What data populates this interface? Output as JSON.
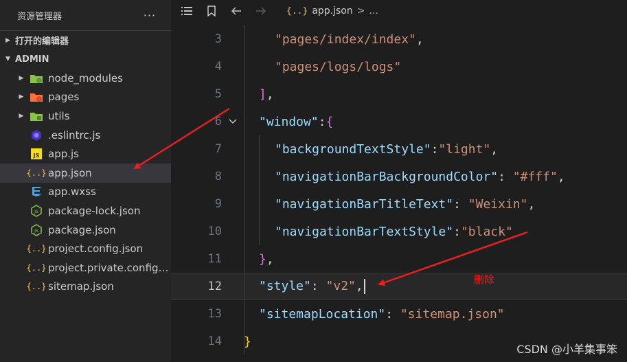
{
  "sidebar": {
    "title": "资源管理器",
    "more_label": "···",
    "open_editors_label": "打开的编辑器",
    "project_label": "ADMIN",
    "items": [
      {
        "label": "node_modules",
        "kind": "folder",
        "icon": "folder-node-icon"
      },
      {
        "label": "pages",
        "kind": "folder",
        "icon": "folder-pages-icon"
      },
      {
        "label": "utils",
        "kind": "folder",
        "icon": "folder-utils-icon"
      },
      {
        "label": ".eslintrc.js",
        "kind": "file",
        "icon": "eslint-icon"
      },
      {
        "label": "app.js",
        "kind": "file",
        "icon": "js-icon"
      },
      {
        "label": "app.json",
        "kind": "file",
        "icon": "json-icon",
        "selected": true
      },
      {
        "label": "app.wxss",
        "kind": "file",
        "icon": "css-icon"
      },
      {
        "label": "package-lock.json",
        "kind": "file",
        "icon": "nodejs-icon"
      },
      {
        "label": "package.json",
        "kind": "file",
        "icon": "nodejs-icon"
      },
      {
        "label": "project.config.json",
        "kind": "file",
        "icon": "json-icon"
      },
      {
        "label": "project.private.config.js...",
        "kind": "file",
        "icon": "json-icon"
      },
      {
        "label": "sitemap.json",
        "kind": "file",
        "icon": "json-icon"
      }
    ]
  },
  "breadcrumb": {
    "file_icon_text": "{..}",
    "file": "app.json",
    "separator": ">",
    "rest": "..."
  },
  "editor": {
    "lines": [
      {
        "num": "3"
      },
      {
        "num": "4"
      },
      {
        "num": "5"
      },
      {
        "num": "6"
      },
      {
        "num": "7"
      },
      {
        "num": "8"
      },
      {
        "num": "9"
      },
      {
        "num": "10"
      },
      {
        "num": "11"
      },
      {
        "num": "12"
      },
      {
        "num": "13"
      },
      {
        "num": "14"
      }
    ],
    "tokens": {
      "l3_str": "\"pages/index/index\"",
      "l3_comma": ",",
      "l4_str": "\"pages/logs/logs\"",
      "l5_bracket": "]",
      "l5_comma": ",",
      "l6_key": "\"window\"",
      "l6_colon": ":",
      "l6_brace": "{",
      "l7_key": "\"backgroundTextStyle\"",
      "l7_colon": ":",
      "l7_val": "\"light\"",
      "l7_comma": ",",
      "l8_key": "\"navigationBarBackgroundColor\"",
      "l8_colon": ": ",
      "l8_val": "\"#fff\"",
      "l8_comma": ",",
      "l9_key": "\"navigationBarTitleText\"",
      "l9_colon": ": ",
      "l9_val": "\"Weixin\"",
      "l9_comma": ",",
      "l10_key": "\"navigationBarTextStyle\"",
      "l10_colon": ":",
      "l10_val": "\"black\"",
      "l11_brace": "}",
      "l11_comma": ",",
      "l12_key": "\"style\"",
      "l12_colon": ": ",
      "l12_val": "\"v2\"",
      "l12_comma": ",",
      "l13_key": "\"sitemapLocation\"",
      "l13_colon": ": ",
      "l13_val": "\"sitemap.json\"",
      "l14_brace": "}"
    }
  },
  "annotation": {
    "text": "删除",
    "color": "#e82020"
  },
  "watermark": "CSDN @小羊集事笨",
  "colors": {
    "sidebar_bg": "#252526",
    "editor_bg": "#1e1e1e",
    "key": "#9cdcfe",
    "string": "#ce9178",
    "arrow": "#e82020"
  }
}
